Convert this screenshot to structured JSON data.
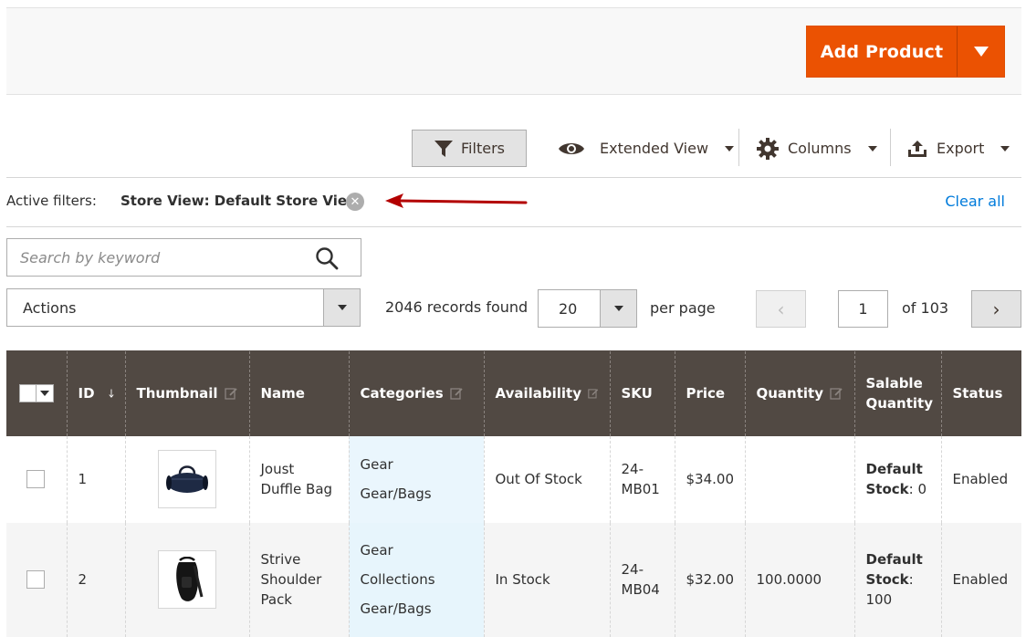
{
  "header": {
    "add_product_label": "Add Product"
  },
  "toolbar": {
    "filters_label": "Filters",
    "view_label": "Extended View",
    "columns_label": "Columns",
    "export_label": "Export"
  },
  "active_filters": {
    "label": "Active filters:",
    "filter_value": "Store View: Default Store View",
    "clear_all_label": "Clear all"
  },
  "search": {
    "placeholder": "Search by keyword"
  },
  "actions": {
    "label": "Actions"
  },
  "paging": {
    "records_found": "2046 records found",
    "per_page_value": "20",
    "per_page_label": "per page",
    "current_page": "1",
    "total_pages_label": "of 103",
    "prev_glyph": "‹",
    "next_glyph": "›"
  },
  "table": {
    "columns": {
      "id": "ID",
      "thumbnail": "Thumbnail",
      "name": "Name",
      "categories": "Categories",
      "availability": "Availability",
      "sku": "SKU",
      "price": "Price",
      "quantity": "Quantity",
      "salable_line1": "Salable",
      "salable_line2": "Quantity",
      "status": "Status"
    },
    "rows": [
      {
        "id": "1",
        "name_line1": "Joust",
        "name_line2": "Duffle Bag",
        "categories": [
          "Gear",
          "Gear/Bags"
        ],
        "availability": "Out Of Stock",
        "sku_line1": "24-",
        "sku_line2": "MB01",
        "price": "$34.00",
        "quantity": "",
        "salable_bold": "Default Stock",
        "salable_value": ": 0",
        "status": "Enabled"
      },
      {
        "id": "2",
        "name_line1": "Strive",
        "name_line2": "Shoulder",
        "name_line3": "Pack",
        "categories": [
          "Gear",
          "Collections",
          "Gear/Bags"
        ],
        "availability": "In Stock",
        "sku_line1": "24-",
        "sku_line2": "MB04",
        "price": "$32.00",
        "quantity": "100.0000",
        "salable_bold_l1": "Default",
        "salable_bold_l2": "Stock",
        "salable_value_l2": ":",
        "salable_value_l3": "100",
        "status": "Enabled"
      }
    ]
  },
  "icons": {
    "filter": "funnel-icon",
    "view": "eye-icon",
    "columns": "gear-icon",
    "export": "upload-icon",
    "search": "magnifier-icon",
    "remove": "close-circle-icon",
    "sort": "arrow-down-icon",
    "edit": "pencil-icon"
  },
  "colors": {
    "accent": "#eb5202",
    "header_bg": "#514943",
    "link": "#007bdb",
    "annotation_arrow": "#b30000"
  }
}
